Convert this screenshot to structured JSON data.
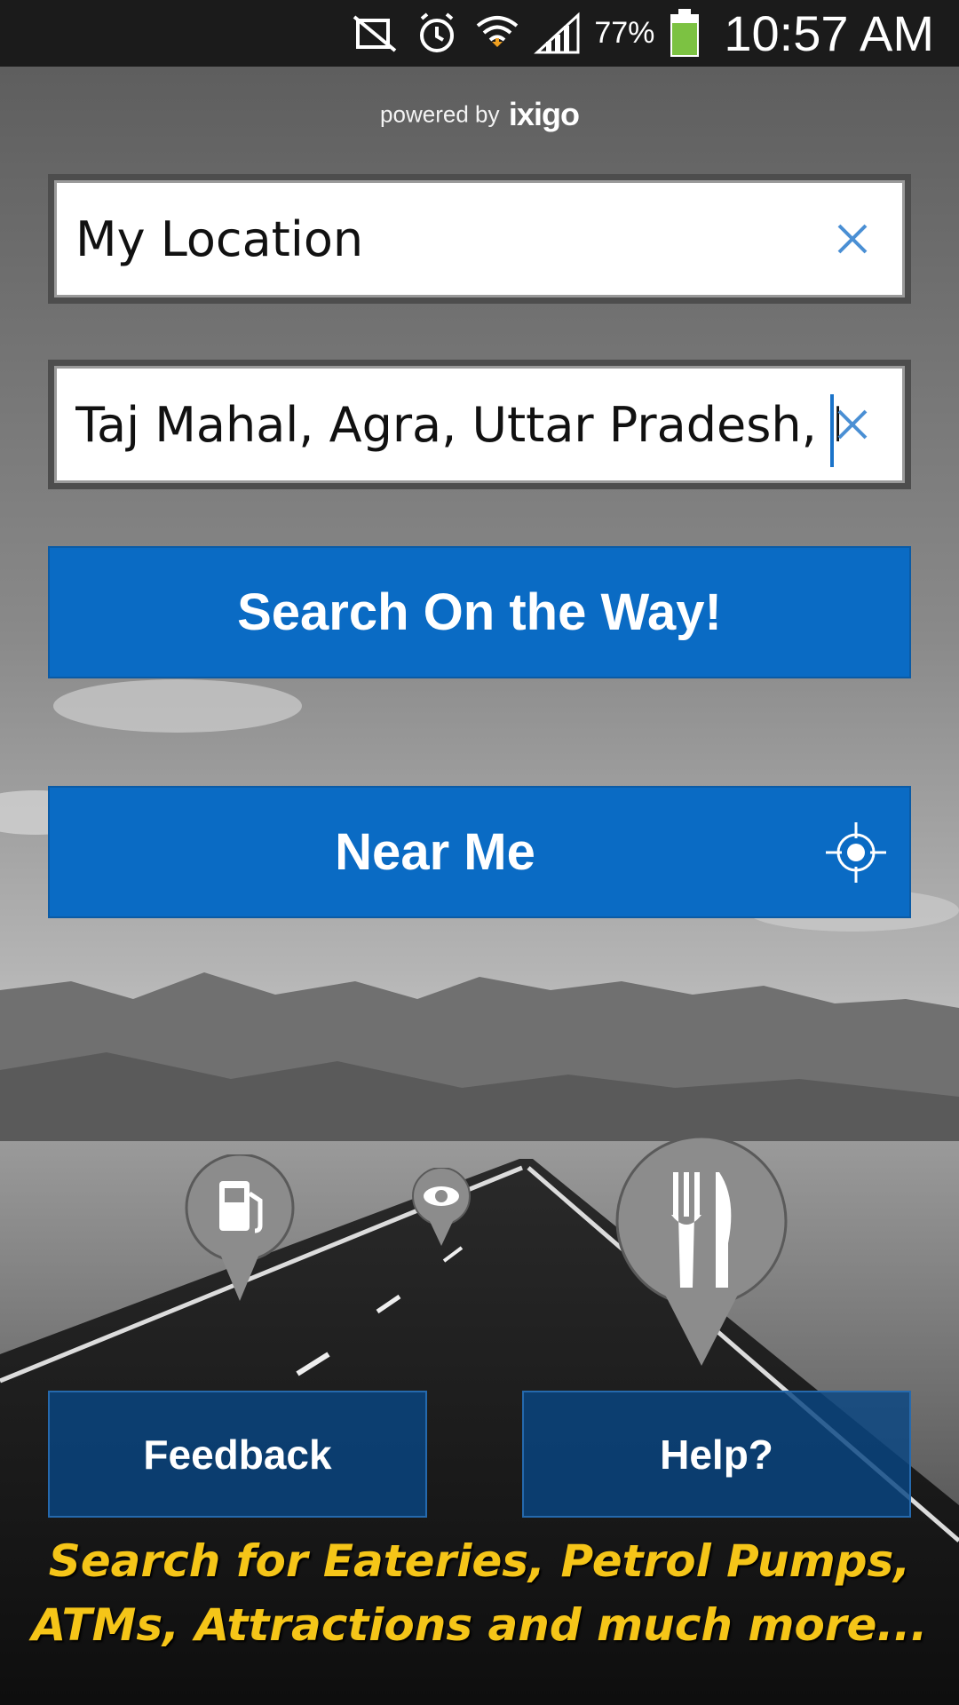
{
  "status_bar": {
    "battery_percent": "77%",
    "time": "10:57 AM",
    "icons": [
      "mute-icon",
      "alarm-icon",
      "wifi-icon",
      "signal-icon",
      "battery-icon"
    ]
  },
  "branding": {
    "powered_by": "powered by",
    "brand": "ixigo"
  },
  "origin": {
    "value": "My Location"
  },
  "destination": {
    "value": "Taj Mahal, Agra, Uttar Pradesh, I"
  },
  "buttons": {
    "search_way": "Search On the Way!",
    "near_me": "Near Me",
    "feedback": "Feedback",
    "help": "Help?"
  },
  "tagline": {
    "line1": "Search for Eateries, Petrol Pumps,",
    "line2": "ATMs, Attractions and much more..."
  },
  "colors": {
    "primary_blue": "#0a6bc4",
    "tagline_yellow": "#f5c518"
  }
}
